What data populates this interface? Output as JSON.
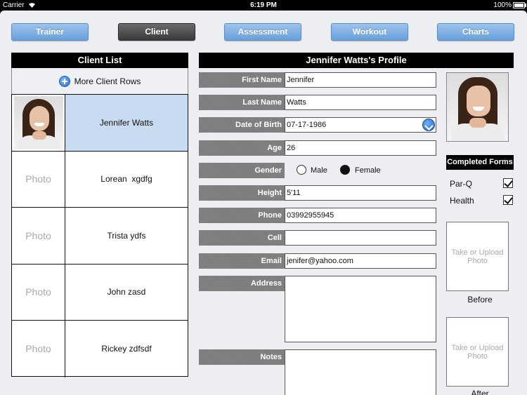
{
  "status_bar": {
    "carrier": "Carrier",
    "time": "6:19 PM",
    "battery": "100%"
  },
  "nav": {
    "trainer": "Trainer",
    "client": "Client",
    "assessment": "Assessment",
    "workout": "Workout",
    "charts": "Charts",
    "active": "Client"
  },
  "client_list": {
    "title": "Client List",
    "more_rows": "More Client Rows",
    "photo_placeholder": "Photo",
    "clients": [
      {
        "name": "Jennifer Watts",
        "selected": true
      },
      {
        "name": "Lorean  xgdfg"
      },
      {
        "name": "Trista ydfs"
      },
      {
        "name": "John zasd"
      },
      {
        "name": "Rickey zdfsdf"
      }
    ]
  },
  "profile": {
    "title": "Jennifer Watts's Profile",
    "labels": {
      "first_name": "First Name",
      "last_name": "Last Name",
      "dob": "Date of Birth",
      "age": "Age",
      "gender": "Gender",
      "height": "Height",
      "phone": "Phone",
      "cell": "Cell",
      "email": "Email",
      "address": "Address",
      "notes": "Notes"
    },
    "values": {
      "first_name": "Jennifer",
      "last_name": "Watts",
      "dob": "07-17-1986",
      "age": "26",
      "height": "5'11",
      "phone": "03992955945",
      "cell": "",
      "email": "jenifer@yahoo.com",
      "address": "",
      "notes": ""
    },
    "gender_options": {
      "male": "Male",
      "female": "Female",
      "selected": "Female"
    }
  },
  "completed_forms": {
    "title": "Completed Forms",
    "items": [
      {
        "label": "Par-Q",
        "checked": true
      },
      {
        "label": "Health",
        "checked": true
      }
    ]
  },
  "photos": {
    "upload_text": "Take or Upload Photo",
    "before": "Before",
    "after": "After"
  },
  "colors": {
    "nav_blue": "#6a9fda",
    "nav_active": "#3a3a3a",
    "selected_row": "#c9dbf0",
    "label_gray": "#7e7e7e"
  }
}
